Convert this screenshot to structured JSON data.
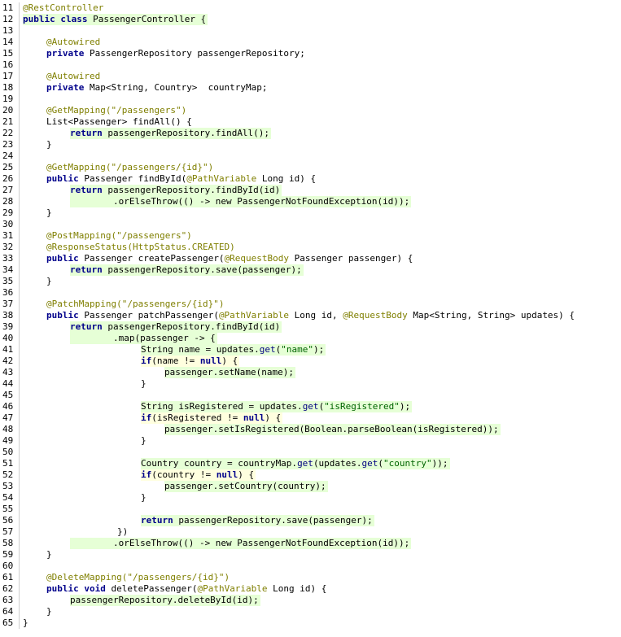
{
  "editor": {
    "colors": {
      "keyword": "#00008b",
      "annotation": "#7f7f00",
      "string": "#006400",
      "method_call": "#000080",
      "added_line_highlight": "#e6ffd6",
      "changed_line_highlight": "#ffffdf"
    },
    "lines": [
      {
        "n": "11",
        "hl": "none",
        "indent": 0,
        "tokens": [
          {
            "t": "@RestController",
            "k": "ann"
          }
        ]
      },
      {
        "n": "12",
        "hl": "green",
        "indent": 0,
        "tokens": [
          {
            "t": "public class",
            "k": "kw"
          },
          {
            "t": " PassengerController {",
            "k": "plain"
          }
        ]
      },
      {
        "n": "13",
        "hl": "none",
        "indent": 0,
        "tokens": []
      },
      {
        "n": "14",
        "hl": "none",
        "indent": 1,
        "tokens": [
          {
            "t": "@Autowired",
            "k": "ann"
          }
        ]
      },
      {
        "n": "15",
        "hl": "none",
        "indent": 1,
        "tokens": [
          {
            "t": "private",
            "k": "kw"
          },
          {
            "t": " PassengerRepository passengerRepository;",
            "k": "plain"
          }
        ]
      },
      {
        "n": "16",
        "hl": "none",
        "indent": 0,
        "tokens": []
      },
      {
        "n": "17",
        "hl": "none",
        "indent": 1,
        "tokens": [
          {
            "t": "@Autowired",
            "k": "ann"
          }
        ]
      },
      {
        "n": "18",
        "hl": "none",
        "indent": 1,
        "tokens": [
          {
            "t": "private",
            "k": "kw"
          },
          {
            "t": " Map<String, Country>  countryMap;",
            "k": "plain"
          }
        ]
      },
      {
        "n": "19",
        "hl": "none",
        "indent": 0,
        "tokens": []
      },
      {
        "n": "20",
        "hl": "none",
        "indent": 1,
        "tokens": [
          {
            "t": "@GetMapping(\"/passengers\")",
            "k": "ann"
          }
        ]
      },
      {
        "n": "21",
        "hl": "none",
        "indent": 1,
        "tokens": [
          {
            "t": "List<Passenger> findAll() {",
            "k": "plain"
          }
        ]
      },
      {
        "n": "22",
        "hl": "green",
        "indent": 2,
        "tokens": [
          {
            "t": "return",
            "k": "kw"
          },
          {
            "t": " passengerRepository.findAll();",
            "k": "plain"
          }
        ]
      },
      {
        "n": "23",
        "hl": "none",
        "indent": 1,
        "tokens": [
          {
            "t": "}",
            "k": "plain"
          }
        ]
      },
      {
        "n": "24",
        "hl": "none",
        "indent": 0,
        "tokens": []
      },
      {
        "n": "25",
        "hl": "none",
        "indent": 1,
        "tokens": [
          {
            "t": "@GetMapping(\"/passengers/{id}\")",
            "k": "ann"
          }
        ]
      },
      {
        "n": "26",
        "hl": "none",
        "indent": 1,
        "tokens": [
          {
            "t": "public",
            "k": "kw"
          },
          {
            "t": " Passenger findById(",
            "k": "plain"
          },
          {
            "t": "@PathVariable",
            "k": "ann"
          },
          {
            "t": " Long id) {",
            "k": "plain"
          }
        ]
      },
      {
        "n": "27",
        "hl": "green",
        "indent": 2,
        "tokens": [
          {
            "t": "return",
            "k": "kw"
          },
          {
            "t": " passengerRepository.findById(id)",
            "k": "plain"
          }
        ]
      },
      {
        "n": "28",
        "hl": "green",
        "indent": 2,
        "tokens": [
          {
            "t": "        .orElseThrow(() -> new PassengerNotFoundException(id));",
            "k": "plain"
          }
        ]
      },
      {
        "n": "29",
        "hl": "none",
        "indent": 1,
        "tokens": [
          {
            "t": "}",
            "k": "plain"
          }
        ]
      },
      {
        "n": "30",
        "hl": "none",
        "indent": 0,
        "tokens": []
      },
      {
        "n": "31",
        "hl": "none",
        "indent": 1,
        "tokens": [
          {
            "t": "@PostMapping(\"/passengers\")",
            "k": "ann"
          }
        ]
      },
      {
        "n": "32",
        "hl": "none",
        "indent": 1,
        "tokens": [
          {
            "t": "@ResponseStatus(HttpStatus.CREATED)",
            "k": "ann"
          }
        ]
      },
      {
        "n": "33",
        "hl": "none",
        "indent": 1,
        "tokens": [
          {
            "t": "public",
            "k": "kw"
          },
          {
            "t": " Passenger createPassenger(",
            "k": "plain"
          },
          {
            "t": "@RequestBody",
            "k": "ann"
          },
          {
            "t": " Passenger passenger) {",
            "k": "plain"
          }
        ]
      },
      {
        "n": "34",
        "hl": "green",
        "indent": 2,
        "tokens": [
          {
            "t": "return",
            "k": "kw"
          },
          {
            "t": " passengerRepository.save(passenger);",
            "k": "plain"
          }
        ]
      },
      {
        "n": "35",
        "hl": "none",
        "indent": 1,
        "tokens": [
          {
            "t": "}",
            "k": "plain"
          }
        ]
      },
      {
        "n": "36",
        "hl": "none",
        "indent": 0,
        "tokens": []
      },
      {
        "n": "37",
        "hl": "none",
        "indent": 1,
        "tokens": [
          {
            "t": "@PatchMapping(\"/passengers/{id}\")",
            "k": "ann"
          }
        ]
      },
      {
        "n": "38",
        "hl": "none",
        "indent": 1,
        "tokens": [
          {
            "t": "public",
            "k": "kw"
          },
          {
            "t": " Passenger patchPassenger(",
            "k": "plain"
          },
          {
            "t": "@PathVariable",
            "k": "ann"
          },
          {
            "t": " Long id, ",
            "k": "plain"
          },
          {
            "t": "@RequestBody",
            "k": "ann"
          },
          {
            "t": " Map<String, String> updates) {",
            "k": "plain"
          }
        ]
      },
      {
        "n": "39",
        "hl": "green",
        "indent": 2,
        "tokens": [
          {
            "t": "return",
            "k": "kw"
          },
          {
            "t": " passengerRepository.findById(id)",
            "k": "plain"
          }
        ]
      },
      {
        "n": "40",
        "hl": "green",
        "indent": 2,
        "tokens": [
          {
            "t": "        .map(passenger -> {",
            "k": "plain"
          }
        ]
      },
      {
        "n": "41",
        "hl": "green",
        "indent": 5,
        "tokens": [
          {
            "t": "String name = updates.",
            "k": "plain"
          },
          {
            "t": "get",
            "k": "call"
          },
          {
            "t": "(",
            "k": "plain"
          },
          {
            "t": "\"name\"",
            "k": "str"
          },
          {
            "t": ");",
            "k": "plain"
          }
        ]
      },
      {
        "n": "42",
        "hl": "yellow",
        "indent": 5,
        "tokens": [
          {
            "t": "if",
            "k": "kw"
          },
          {
            "t": "(name != ",
            "k": "plain"
          },
          {
            "t": "null",
            "k": "kw"
          },
          {
            "t": ") {",
            "k": "plain"
          }
        ]
      },
      {
        "n": "43",
        "hl": "green",
        "indent": 6,
        "tokens": [
          {
            "t": "passenger.setName(name);",
            "k": "plain"
          }
        ]
      },
      {
        "n": "44",
        "hl": "none",
        "indent": 5,
        "tokens": [
          {
            "t": "}",
            "k": "plain"
          }
        ]
      },
      {
        "n": "45",
        "hl": "none",
        "indent": 0,
        "tokens": []
      },
      {
        "n": "46",
        "hl": "green",
        "indent": 5,
        "tokens": [
          {
            "t": "String isRegistered = updates.",
            "k": "plain"
          },
          {
            "t": "get",
            "k": "call"
          },
          {
            "t": "(",
            "k": "plain"
          },
          {
            "t": "\"isRegistered\"",
            "k": "str"
          },
          {
            "t": ");",
            "k": "plain"
          }
        ]
      },
      {
        "n": "47",
        "hl": "yellow",
        "indent": 5,
        "tokens": [
          {
            "t": "if",
            "k": "kw"
          },
          {
            "t": "(isRegistered != ",
            "k": "plain"
          },
          {
            "t": "null",
            "k": "kw"
          },
          {
            "t": ") {",
            "k": "plain"
          }
        ]
      },
      {
        "n": "48",
        "hl": "green",
        "indent": 6,
        "tokens": [
          {
            "t": "passenger.setIsRegistered(Boolean.parseBoolean(isRegistered));",
            "k": "plain"
          }
        ]
      },
      {
        "n": "49",
        "hl": "none",
        "indent": 5,
        "tokens": [
          {
            "t": "}",
            "k": "plain"
          }
        ]
      },
      {
        "n": "50",
        "hl": "none",
        "indent": 0,
        "tokens": []
      },
      {
        "n": "51",
        "hl": "green",
        "indent": 5,
        "tokens": [
          {
            "t": "Country country = countryMap.",
            "k": "plain"
          },
          {
            "t": "get",
            "k": "call"
          },
          {
            "t": "(updates.",
            "k": "plain"
          },
          {
            "t": "get",
            "k": "call"
          },
          {
            "t": "(",
            "k": "plain"
          },
          {
            "t": "\"country\"",
            "k": "str"
          },
          {
            "t": "));",
            "k": "plain"
          }
        ]
      },
      {
        "n": "52",
        "hl": "yellow",
        "indent": 5,
        "tokens": [
          {
            "t": "if",
            "k": "kw"
          },
          {
            "t": "(country != ",
            "k": "plain"
          },
          {
            "t": "null",
            "k": "kw"
          },
          {
            "t": ") {",
            "k": "plain"
          }
        ]
      },
      {
        "n": "53",
        "hl": "green",
        "indent": 6,
        "tokens": [
          {
            "t": "passenger.setCountry(country);",
            "k": "plain"
          }
        ]
      },
      {
        "n": "54",
        "hl": "none",
        "indent": 5,
        "tokens": [
          {
            "t": "}",
            "k": "plain"
          }
        ]
      },
      {
        "n": "55",
        "hl": "none",
        "indent": 0,
        "tokens": []
      },
      {
        "n": "56",
        "hl": "green",
        "indent": 5,
        "tokens": [
          {
            "t": "return",
            "k": "kw"
          },
          {
            "t": " passengerRepository.save(passenger);",
            "k": "plain"
          }
        ]
      },
      {
        "n": "57",
        "hl": "none",
        "indent": 4,
        "tokens": [
          {
            "t": "})",
            "k": "plain"
          }
        ]
      },
      {
        "n": "58",
        "hl": "green",
        "indent": 2,
        "tokens": [
          {
            "t": "        .orElseThrow(() -> new PassengerNotFoundException(id));",
            "k": "plain"
          }
        ]
      },
      {
        "n": "59",
        "hl": "none",
        "indent": 1,
        "tokens": [
          {
            "t": "}",
            "k": "plain"
          }
        ]
      },
      {
        "n": "60",
        "hl": "none",
        "indent": 0,
        "tokens": []
      },
      {
        "n": "61",
        "hl": "none",
        "indent": 1,
        "tokens": [
          {
            "t": "@DeleteMapping(\"/passengers/{id}\")",
            "k": "ann"
          }
        ]
      },
      {
        "n": "62",
        "hl": "none",
        "indent": 1,
        "tokens": [
          {
            "t": "public void",
            "k": "kw"
          },
          {
            "t": " deletePassenger(",
            "k": "plain"
          },
          {
            "t": "@PathVariable",
            "k": "ann"
          },
          {
            "t": " Long id) {",
            "k": "plain"
          }
        ]
      },
      {
        "n": "63",
        "hl": "green",
        "indent": 2,
        "tokens": [
          {
            "t": "passengerRepository.deleteById(id);",
            "k": "plain"
          }
        ]
      },
      {
        "n": "64",
        "hl": "none",
        "indent": 1,
        "tokens": [
          {
            "t": "}",
            "k": "plain"
          }
        ]
      },
      {
        "n": "65",
        "hl": "none",
        "indent": 0,
        "tokens": [
          {
            "t": "}",
            "k": "plain"
          }
        ]
      }
    ]
  }
}
